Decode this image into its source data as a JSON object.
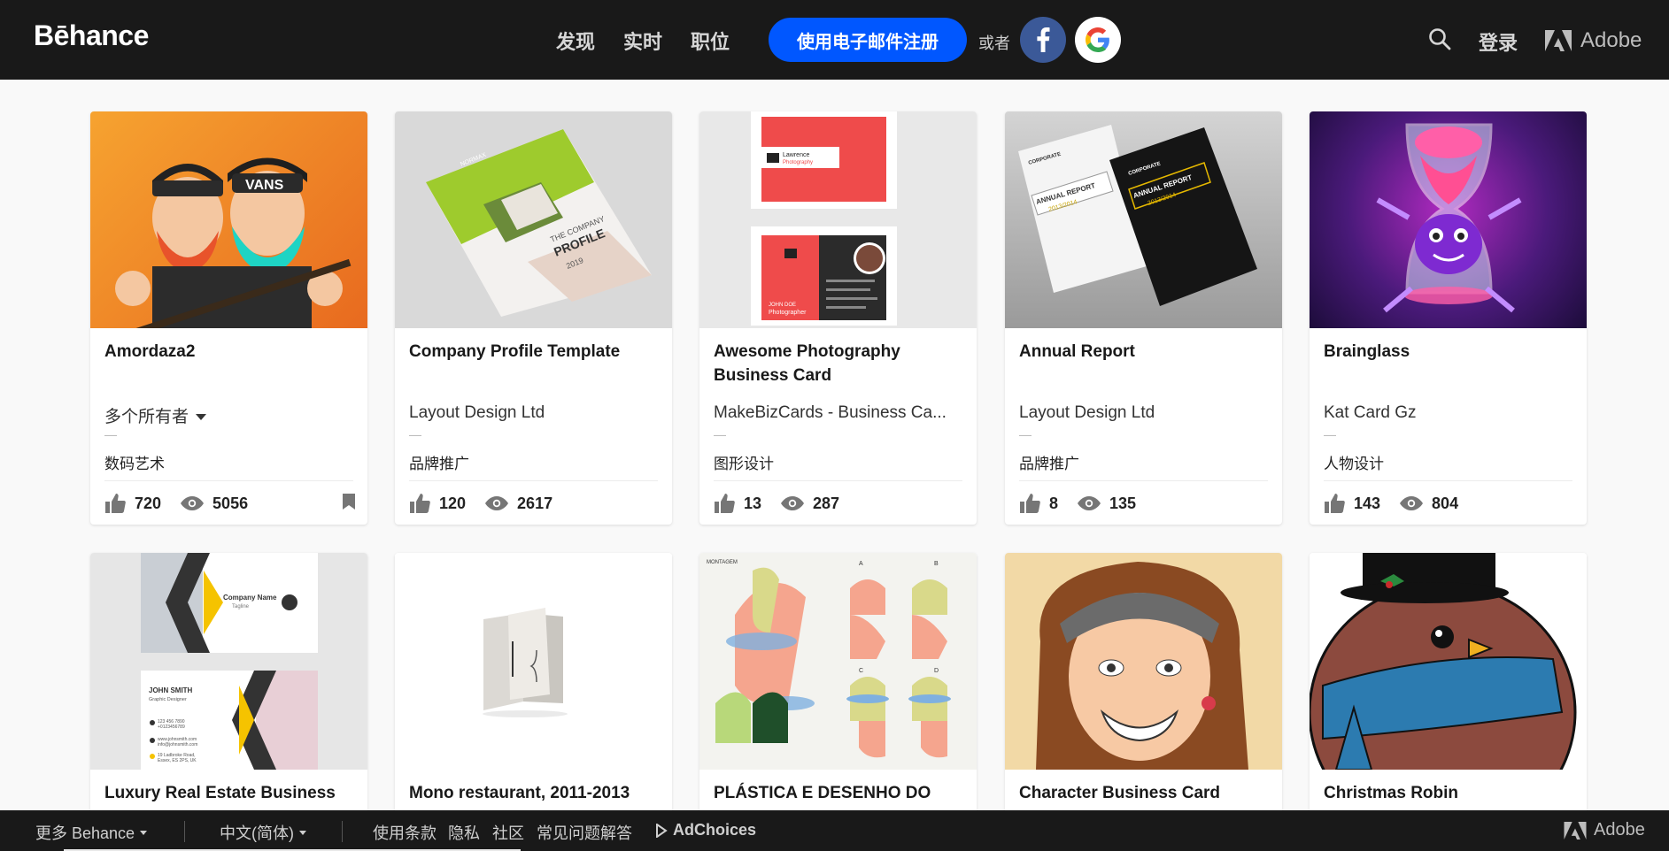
{
  "header": {
    "logo": "Bēhance",
    "nav": [
      "发现",
      "实时",
      "职位"
    ],
    "signup_label": "使用电子邮件注册",
    "or_label": "或者",
    "login_label": "登录",
    "adobe_label": "Adobe"
  },
  "projects": [
    {
      "title": "Amordaza2",
      "owner": "多个所有者",
      "field": "数码艺术",
      "likes": "720",
      "views": "5056"
    },
    {
      "title": "Company Profile Template",
      "owner": "Layout Design Ltd",
      "field": "品牌推广",
      "likes": "120",
      "views": "2617"
    },
    {
      "title": "Awesome Photography Business Card",
      "owner": "MakeBizCards - Business Ca...",
      "field": "图形设计",
      "likes": "13",
      "views": "287"
    },
    {
      "title": "Annual Report",
      "owner": "Layout Design Ltd",
      "field": "品牌推广",
      "likes": "8",
      "views": "135"
    },
    {
      "title": "Brainglass",
      "owner": "Kat Card Gz",
      "field": "人物设计",
      "likes": "143",
      "views": "804"
    },
    {
      "title": "Luxury Real Estate Business"
    },
    {
      "title": "Mono restaurant, 2011-2013"
    },
    {
      "title": "PLÁSTICA E DESENHO DO"
    },
    {
      "title": "Character Business Card"
    },
    {
      "title": "Christmas Robin"
    }
  ],
  "thumb_text": {
    "p2_brand": "NORMAX",
    "p2_line1": "THE COMPANY",
    "p2_line2": "PROFILE",
    "p2_year": "2019",
    "p3_name": "Lawrence",
    "p3_sub": "Photography",
    "p3_jd1": "JOHN DOE",
    "p3_jd2": "Photographer",
    "p4_corp": "CORPORATE",
    "p4_ar": "ANNUAL REPORT",
    "p4_years": "2013/2014",
    "p6_company": "Company Name",
    "p6_tagline": "Tagline",
    "p6_person": "JOHN SMITH",
    "p6_role": "Graphic Designer",
    "p6_phone1": "123 456 7890",
    "p6_phone2": "+0123456789",
    "p6_web": "www.johnsmith.com",
    "p6_mail": "info@johnsmith.com",
    "p6_addr1": "19 Ladbroke Road,",
    "p6_addr2": "Essex, ES 2PS, UK",
    "p8_title": "MONTAGEM",
    "p8_a": "A",
    "p8_b": "B",
    "p8_c": "C",
    "p8_d": "D"
  },
  "footer": {
    "more": "更多 Behance",
    "language": "中文(简体)",
    "links": [
      "使用条款",
      "隐私",
      "社区",
      "常见问题解答"
    ],
    "adchoices": "AdChoices",
    "adobe": "Adobe"
  },
  "colors": {
    "header_bg": "#191919",
    "signup_blue": "#0057ff",
    "facebook": "#3b5998"
  }
}
